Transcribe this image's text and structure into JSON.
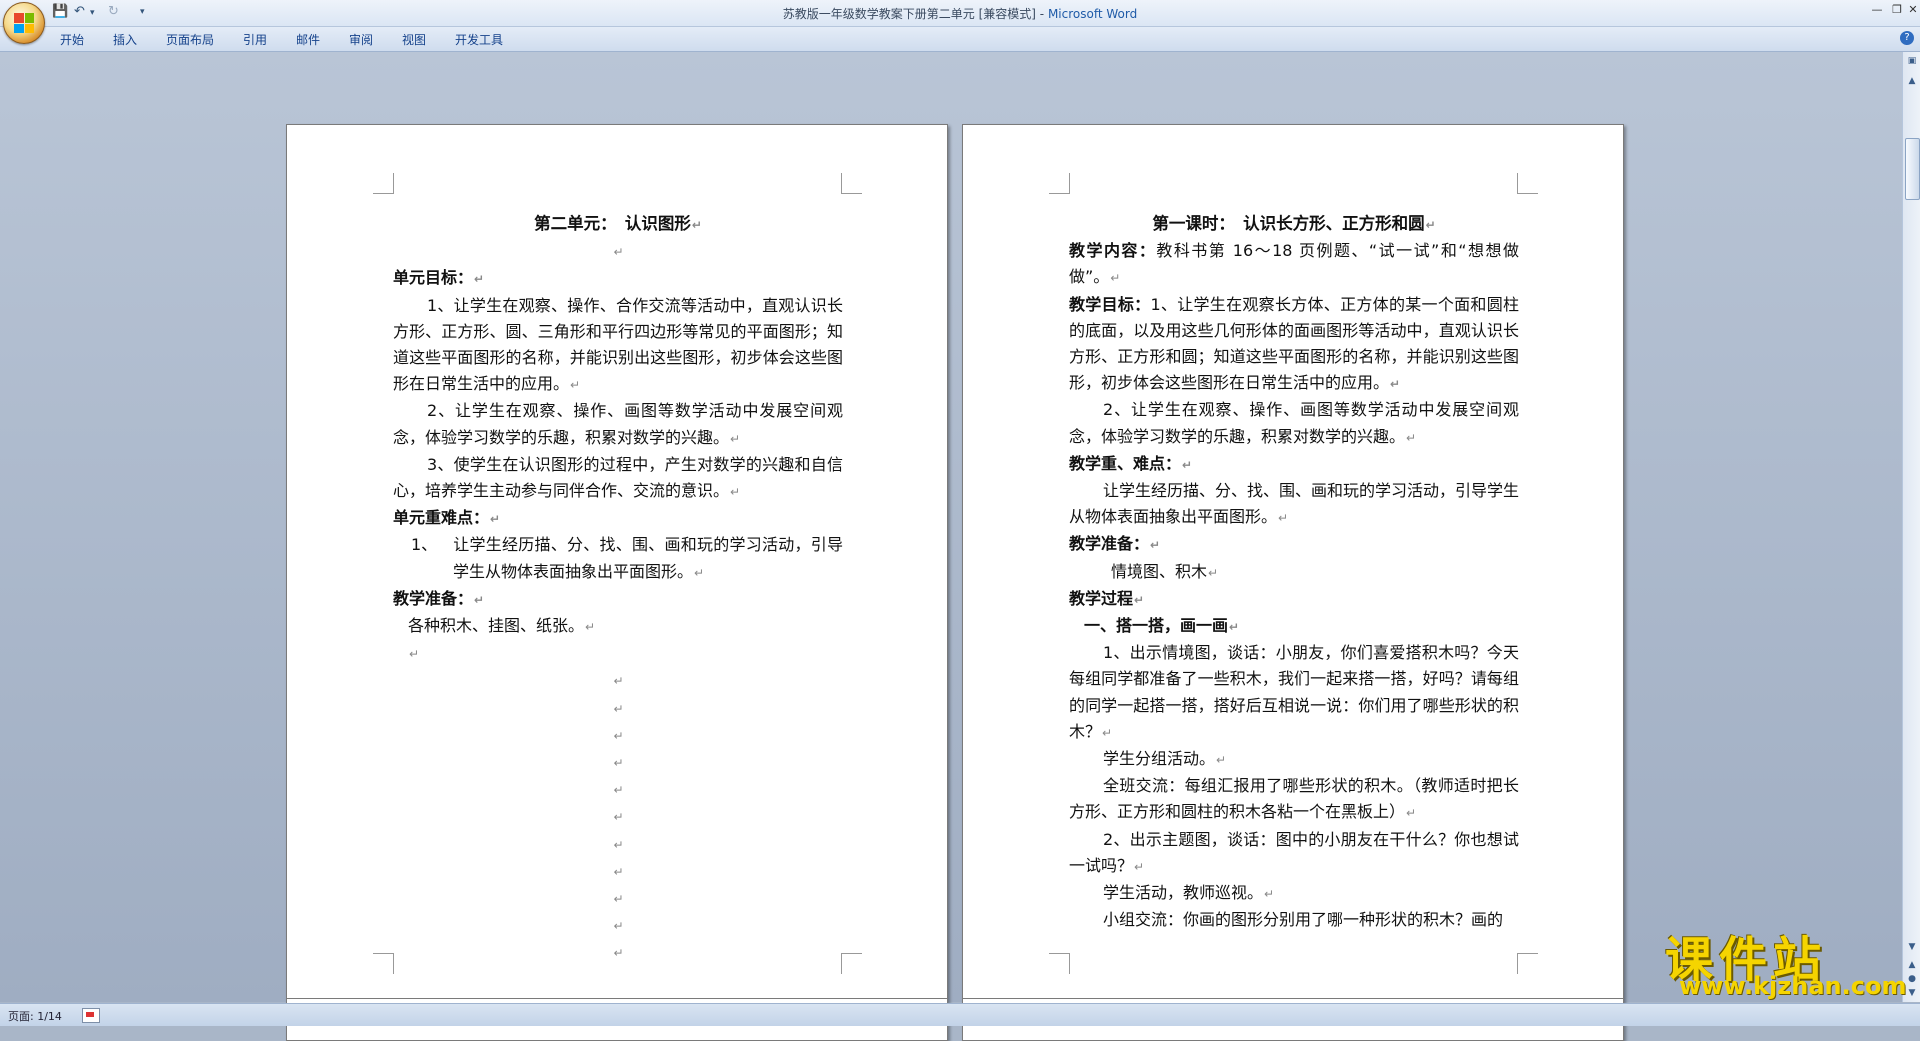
{
  "window": {
    "title": "苏教版一年级数学教案下册第二单元 [兼容模式]",
    "separator": " - ",
    "app_name": "Microsoft Word"
  },
  "quick_access": {
    "save_icon": "save-icon",
    "undo_icon": "undo-icon",
    "redo_icon": "redo-icon"
  },
  "ribbon": {
    "tabs": [
      "开始",
      "插入",
      "页面布局",
      "引用",
      "邮件",
      "审阅",
      "视图",
      "开发工具"
    ]
  },
  "page1": {
    "title": "第二单元：　认识图形",
    "goal_heading": "单元目标：",
    "goal_1": "1、让学生在观察、操作、合作交流等活动中，直观认识长方形、正方形、圆、三角形和平行四边形等常见的平面图形；知道这些平面图形的名称，并能识别出这些图形，初步体会这些图形在日常生活中的应用。",
    "goal_2": "2、让学生在观察、操作、画图等数学活动中发展空间观念，体验学习数学的乐趣，积累对数学的兴趣。",
    "goal_3": "3、使学生在认识图形的过程中，产生对数学的兴趣和自信心，培养学生主动参与同伴合作、交流的意识。",
    "key_heading": "单元重难点：",
    "key_1_num": "1、",
    "key_1": "让学生经历描、分、找、围、画和玩的学习活动，引导学生从物体表面抽象出平面图形。",
    "prep_heading": "教学准备：",
    "prep": "各种积木、挂图、纸张。"
  },
  "page2": {
    "title": "第一课时：　认识长方形、正方形和圆",
    "content_heading": "教学内容：",
    "content": "教科书第 16～18 页例题、“试一试”和“想想做做”。",
    "goal_heading": "教学目标：",
    "goal_1": "1、让学生在观察长方体、正方体的某一个面和圆柱的底面，以及用这些几何形体的面画图形等活动中，直观认识长方形、正方形和圆；知道这些平面图形的名称，并能识别这些图形，初步体会这些图形在日常生活中的应用。",
    "goal_2": "2、让学生在观察、操作、画图等数学活动中发展空间观念，体验学习数学的乐趣，积累对数学的兴趣。",
    "key_heading": "教学重、难点：",
    "key": "让学生经历描、分、找、围、画和玩的学习活动，引导学生从物体表面抽象出平面图形。",
    "prep_heading": "教学准备：",
    "prep": "情境图、积木",
    "process_heading": "教学过程",
    "section_1": "一、搭一搭，画一画",
    "step_1": "1、出示情境图，谈话：小朋友，你们喜爱搭积木吗？今天每组同学都准备了一些积木，我们一起来搭一搭，好吗？请每组的同学一起搭一搭，搭好后互相说一说：你们用了哪些形状的积木？",
    "step_1a": "学生分组活动。",
    "step_1b": "全班交流：每组汇报用了哪些形状的积木。（教师适时把长方形、正方形和圆柱的积木各粘一个在黑板上）",
    "step_2": "2、出示主题图，谈话：图中的小朋友在干什么？你也想试一试吗？",
    "step_2a": "学生活动，教师巡视。",
    "step_2b": "小组交流：你画的图形分别用了哪一种形状的积木？画的"
  },
  "status": {
    "page": "页面: 1/14"
  },
  "watermark": {
    "title": "课件站",
    "url": "www.kjzhan.com"
  },
  "paragraph_mark": "↵"
}
